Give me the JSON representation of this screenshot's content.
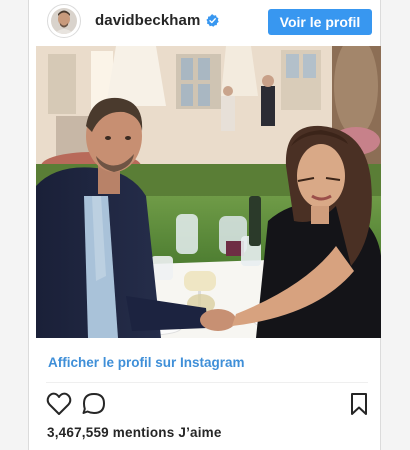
{
  "post": {
    "username": "davidbeckham",
    "verified_icon": "verified-check-icon",
    "follow_button_label": "Voir le profil",
    "photo_description_icon": "post-photo",
    "view_profile_link": "Afficher le profil sur Instagram",
    "likes_text": "3,467,559 mentions J’aime"
  },
  "actions": {
    "like_icon": "heart-icon",
    "comment_icon": "comment-icon",
    "save_icon": "bookmark-icon"
  },
  "colors": {
    "accent": "#3897f0",
    "link": "#3f8fd8",
    "text": "#262626",
    "background": "#f4f4f4"
  }
}
